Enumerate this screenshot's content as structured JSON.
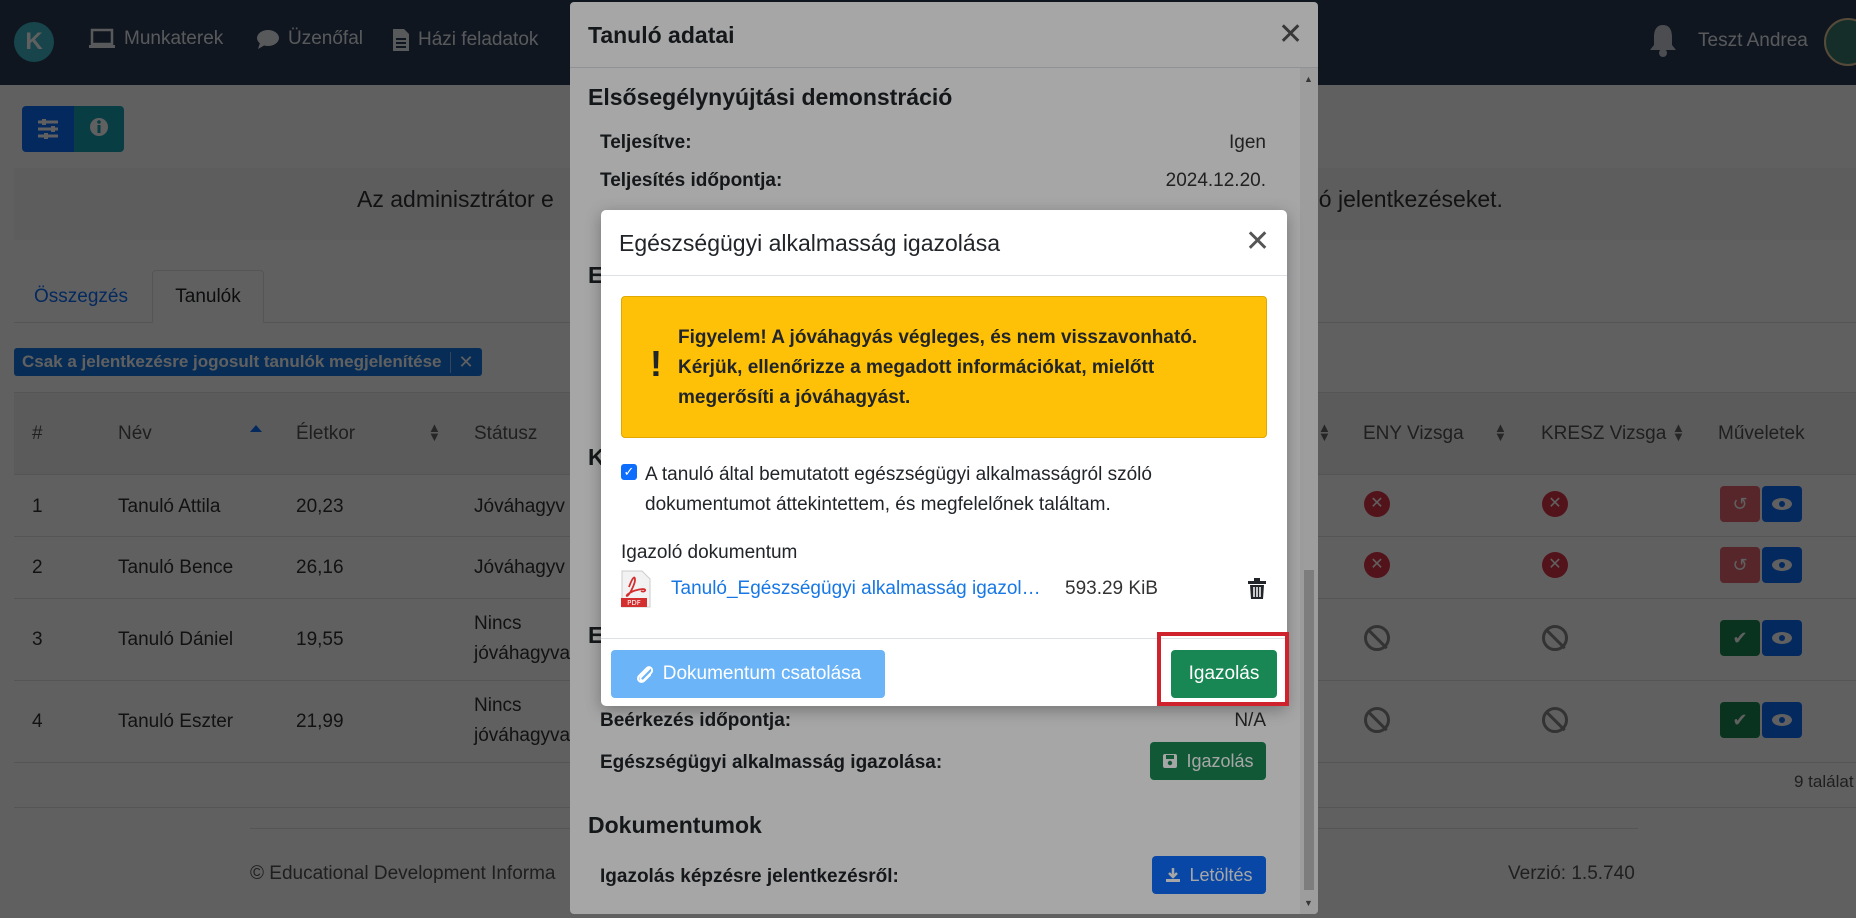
{
  "navbar": {
    "logo": "K",
    "items": [
      {
        "label": "Munkaterek",
        "icon": "laptop-icon"
      },
      {
        "label": "Üzenőfal",
        "icon": "chat-icon"
      },
      {
        "label": "Házi feladatok",
        "icon": "document-icon"
      }
    ],
    "user_name": "Teszt Andrea"
  },
  "page": {
    "info_text_left": "Az adminisztrátor e",
    "info_text_right": "dó jelentkezéseket.",
    "tabs": [
      "Összegzés",
      "Tanulók"
    ],
    "filter_label": "Csak a jelentkezésre jogosult tanulók megjelenítése",
    "filter_close": "✕",
    "table": {
      "headers": [
        "#",
        "Név",
        "Életkor",
        "Státusz",
        "ENY Vizsga",
        "KRESZ Vizsga",
        "Műveletek"
      ],
      "rows": [
        {
          "num": "1",
          "name": "Tanuló Attila",
          "age": "20,23",
          "status": "Jóváhagyv"
        },
        {
          "num": "2",
          "name": "Tanuló Bence",
          "age": "26,16",
          "status": "Jóváhagyv"
        },
        {
          "num": "3",
          "name": "Tanuló Dániel",
          "age": "19,55",
          "status_line1": "Nincs",
          "status_line2": "jóváhagyva"
        },
        {
          "num": "4",
          "name": "Tanuló Eszter",
          "age": "21,99",
          "status_line1": "Nincs",
          "status_line2": "jóváhagyva"
        }
      ]
    },
    "results": "9 találat",
    "footer_left": "© Educational Development Informa",
    "footer_right": "Verzió: 1.5.740"
  },
  "outer_modal": {
    "title": "Tanuló adatai",
    "section1_title": "Elsősegélynyújtási demonstráció",
    "completed_label": "Teljesítve:",
    "completed_value": "Igen",
    "completed_date_label": "Teljesítés időpontja:",
    "completed_date_value": "2024.12.20.",
    "hidden_section_letters": [
      "E",
      "K",
      "E"
    ],
    "arrival_label": "Beérkezés időpontja:",
    "arrival_value": "N/A",
    "health_label": "Egészségügyi alkalmasság igazolása:",
    "health_button": "Igazolás",
    "docs_title": "Dokumentumok",
    "cert_label": "Igazolás képzésre jelentkezésről:",
    "download_button": "Letöltés"
  },
  "inner_modal": {
    "title": "Egészségügyi alkalmasság igazolása",
    "alert_text": "Figyelem! A jóváhagyás végleges, és nem visszavonható. Kérjük, ellenőrizze a megadott információkat, mielőtt megerősíti a jóváhagyást.",
    "alert_mark": "!",
    "checkbox_label": "A tanuló által bemutatott egészségügyi alkalmasságról szóló dokumentumot áttekintettem, és megfelelőnek találtam.",
    "checkbox_checked": true,
    "doc_section_label": "Igazoló dokumentum",
    "doc_name": "Tanuló_Egészségügyi alkalmasság igazolás.pdf",
    "doc_size": "593.29 KiB",
    "pdf_label": "PDF",
    "attach_button": "Dokumentum csatolása",
    "confirm_button": "Igazolás"
  },
  "colors": {
    "navbar": "#2b3d57",
    "primary": "#0d6efd",
    "success": "#198754",
    "warning": "#ffc107",
    "danger": "#dc3545",
    "highlight": "#d0222c"
  }
}
